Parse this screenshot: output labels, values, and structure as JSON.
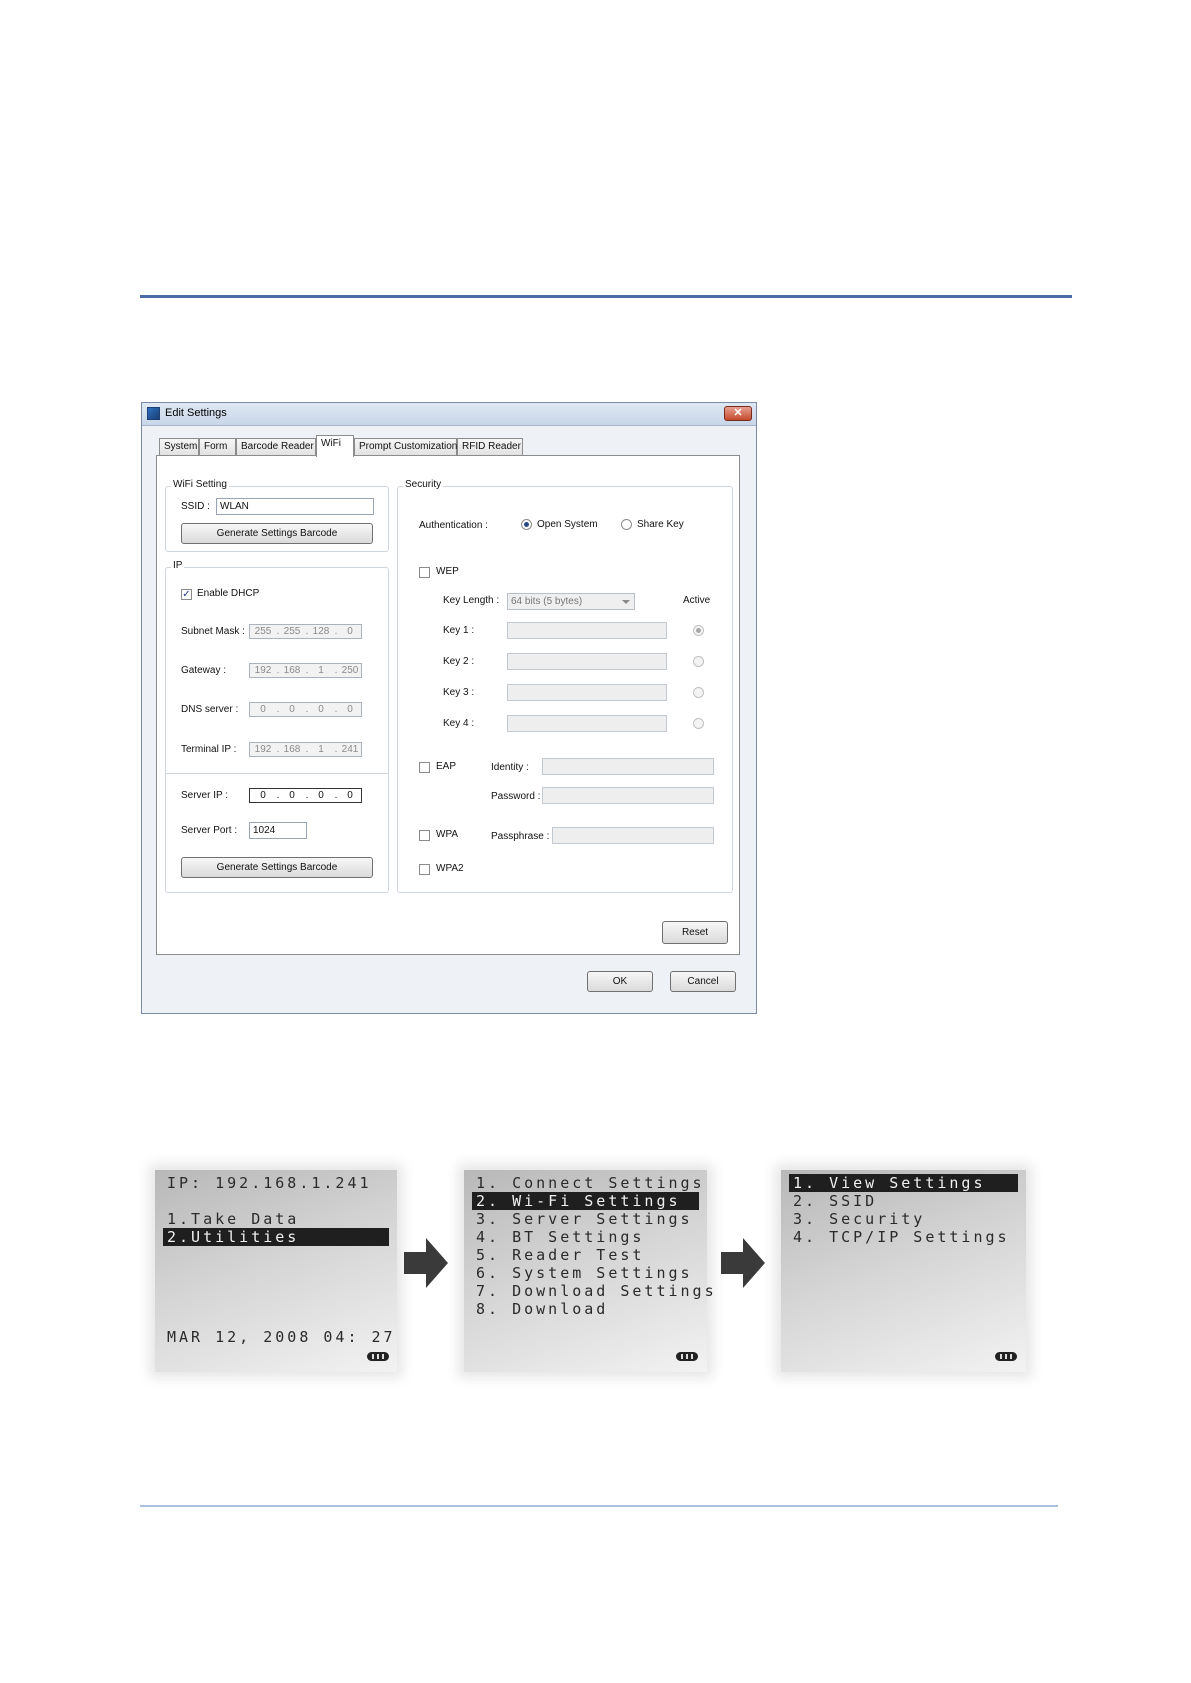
{
  "dialog": {
    "title": "Edit Settings",
    "close_glyph": "✕",
    "tabs": [
      {
        "label": "System"
      },
      {
        "label": "Form"
      },
      {
        "label": "Barcode Reader"
      },
      {
        "label": "WiFi"
      },
      {
        "label": "Prompt Customization"
      },
      {
        "label": "RFID Reader"
      }
    ],
    "active_tab": "WiFi",
    "wifi_setting": {
      "title": "WiFi Setting",
      "ssid_label": "SSID :",
      "ssid_value": "WLAN",
      "generate_button": "Generate Settings Barcode"
    },
    "ip": {
      "title": "IP",
      "enable_dhcp_label": "Enable DHCP",
      "enable_dhcp_checked": true,
      "check_glyph": "✓",
      "subnet_label": "Subnet Mask :",
      "subnet": [
        "255",
        "255",
        "128",
        "0"
      ],
      "gateway_label": "Gateway :",
      "gateway": [
        "192",
        "168",
        "1",
        "250"
      ],
      "dns_label": "DNS server :",
      "dns": [
        "0",
        "0",
        "0",
        "0"
      ],
      "terminal_label": "Terminal IP :",
      "terminal": [
        "192",
        "168",
        "1",
        "241"
      ],
      "server_ip_label": "Server IP :",
      "server_ip": [
        "0",
        "0",
        "0",
        "0"
      ],
      "server_port_label": "Server Port :",
      "server_port": "1024",
      "generate_button": "Generate Settings Barcode"
    },
    "security": {
      "title": "Security",
      "authentication_label": "Authentication :",
      "open_system_label": "Open System",
      "share_key_label": "Share Key",
      "auth_selected": "Open System",
      "wep_label": "WEP",
      "key_length_label": "Key Length :",
      "key_length_value": "64 bits (5 bytes)",
      "active_label": "Active",
      "keys": [
        {
          "label": "Key 1 :",
          "active": true
        },
        {
          "label": "Key 2 :",
          "active": false
        },
        {
          "label": "Key 3 :",
          "active": false
        },
        {
          "label": "Key 4 :",
          "active": false
        }
      ],
      "eap_label": "EAP",
      "identity_label": "Identity :",
      "password_label": "Password :",
      "wpa_label": "WPA",
      "passphrase_label": "Passphrase :",
      "wpa2_label": "WPA2"
    },
    "reset_button": "Reset",
    "ok_button": "OK",
    "cancel_button": "Cancel"
  },
  "screens": [
    {
      "lines": [
        {
          "text": "IP: 192.168.1.241",
          "selected": false
        },
        {
          "text": "",
          "selected": false
        },
        {
          "text": "1.Take Data",
          "selected": false
        },
        {
          "text": "2.Utilities",
          "selected": true
        }
      ],
      "footer": "MAR 12, 2008 04: 27"
    },
    {
      "lines": [
        {
          "text": "1. Connect Settings",
          "selected": false
        },
        {
          "text": "2. Wi-Fi Settings",
          "selected": true
        },
        {
          "text": "3. Server Settings",
          "selected": false
        },
        {
          "text": "4. BT Settings",
          "selected": false
        },
        {
          "text": "5. Reader Test",
          "selected": false
        },
        {
          "text": "6. System Settings",
          "selected": false
        },
        {
          "text": "7. Download Settings",
          "selected": false
        },
        {
          "text": "8. Download",
          "selected": false
        }
      ],
      "footer": ""
    },
    {
      "lines": [
        {
          "text": "1. View Settings",
          "selected": true
        },
        {
          "text": "2. SSID",
          "selected": false
        },
        {
          "text": "3. Security",
          "selected": false
        },
        {
          "text": "4. TCP/IP Settings",
          "selected": false
        }
      ],
      "footer": ""
    }
  ]
}
